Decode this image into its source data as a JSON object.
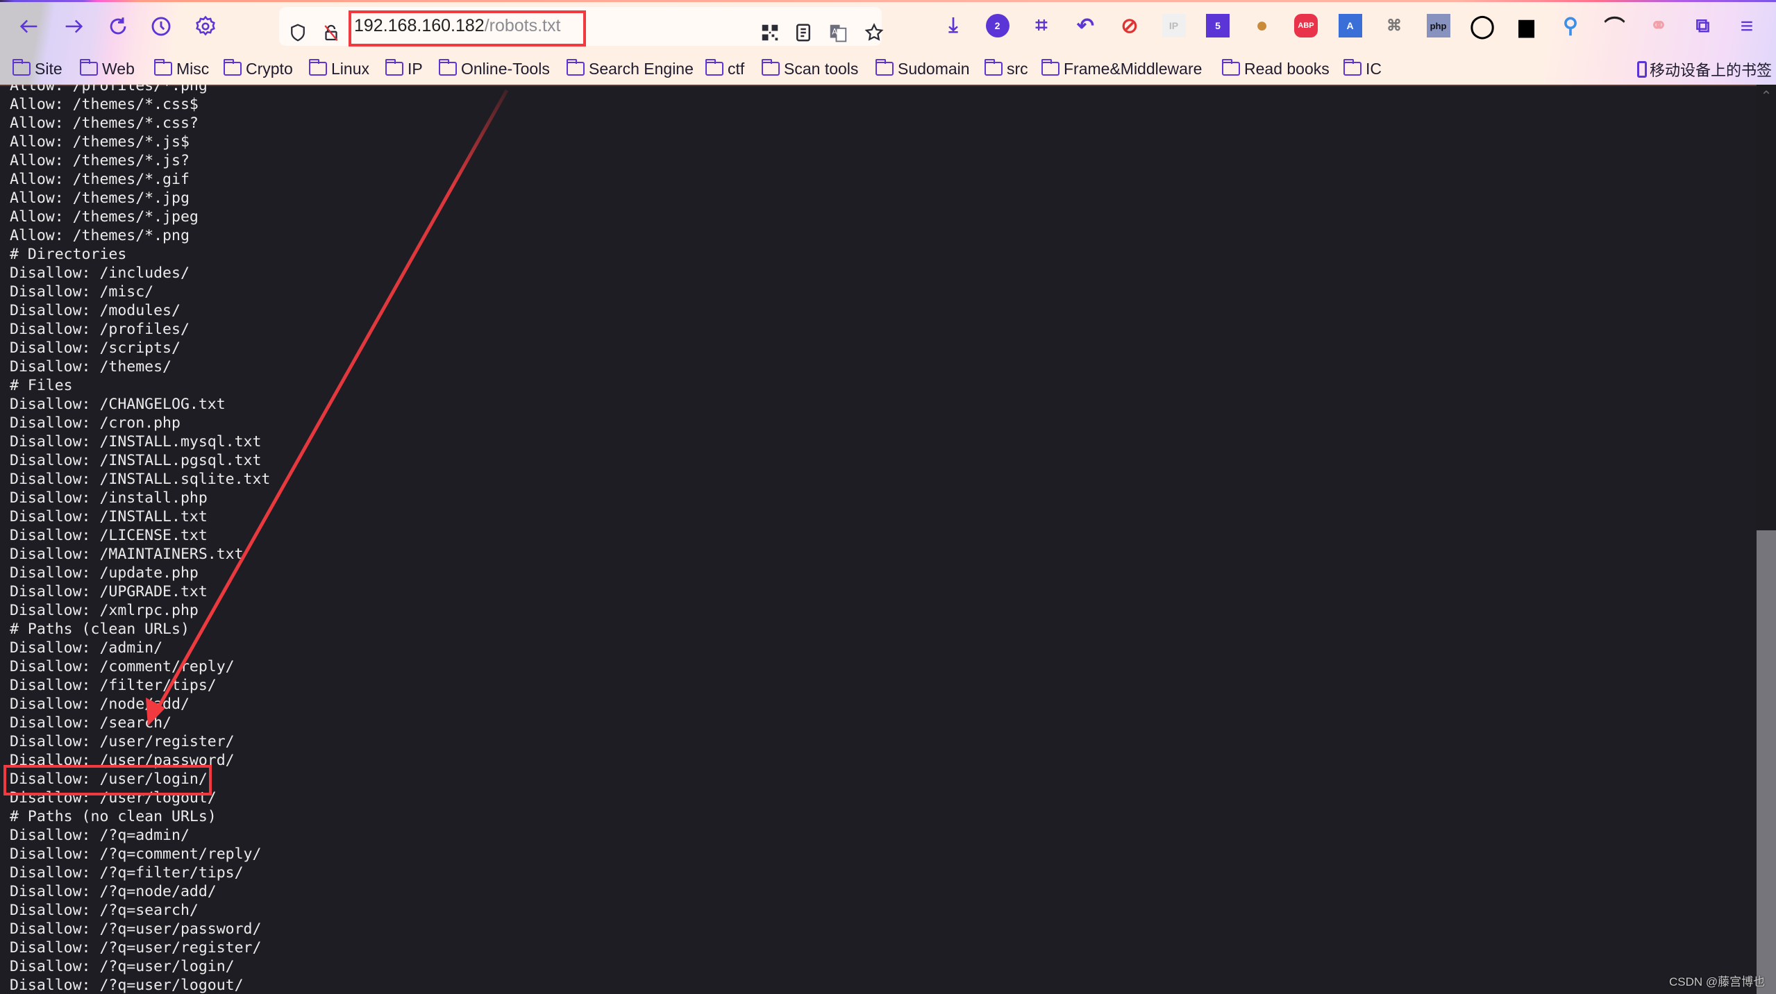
{
  "browser": {
    "nav": {
      "back_icon": "arrow-left-icon",
      "forward_icon": "arrow-right-icon",
      "reload_icon": "reload-icon",
      "history_icon": "clock-icon",
      "settings_icon": "gear-icon"
    },
    "url": {
      "host": "192.168.160.182",
      "path": "/robots.txt",
      "security_icon": "shield-icon",
      "insecure_icon": "lock-slash-icon"
    },
    "url_actions": [
      "qr-code-icon",
      "reader-view-icon",
      "translate-icon",
      "bookmark-star-icon"
    ],
    "extensions": [
      {
        "name": "download-icon",
        "label": ""
      },
      {
        "name": "extension-2-icon",
        "label": "2"
      },
      {
        "name": "crop-icon",
        "label": ""
      },
      {
        "name": "undo-icon",
        "label": ""
      },
      {
        "name": "no-cookie-icon",
        "label": ""
      },
      {
        "name": "ip-icon",
        "label": "IP"
      },
      {
        "name": "hackbar-icon",
        "label": "5"
      },
      {
        "name": "cookie-icon",
        "label": ""
      },
      {
        "name": "adblock-icon",
        "label": "ABP"
      },
      {
        "name": "translate-ext-icon",
        "label": "A"
      },
      {
        "name": "cmd-icon",
        "label": "⌘"
      },
      {
        "name": "php-icon",
        "label": "php"
      },
      {
        "name": "ring-icon",
        "label": ""
      },
      {
        "name": "glasses-icon",
        "label": ""
      },
      {
        "name": "pin-icon",
        "label": ""
      },
      {
        "name": "hat-icon",
        "label": ""
      },
      {
        "name": "cluster-icon",
        "label": ""
      },
      {
        "name": "puzzle-icon",
        "label": ""
      },
      {
        "name": "menu-icon",
        "label": "≡"
      }
    ],
    "bookmarks": [
      "Site",
      "Web",
      "Misc",
      "Crypto",
      "Linux",
      "IP",
      "Online-Tools",
      "Search Engine",
      "ctf",
      "Scan tools",
      "Sudomain",
      "src",
      "Frame&Middleware",
      "Read books",
      "IC"
    ],
    "mobile_bookmarks": "移动设备上的书签"
  },
  "accent_colors": {
    "icon": "#5b35d5",
    "annotation": "#f03a3f",
    "page_background": "#1e1d23",
    "text": "#ececec"
  },
  "robots_lines": [
    "Allow: /profiles/*.png",
    "Allow: /themes/*.css$",
    "Allow: /themes/*.css?",
    "Allow: /themes/*.js$",
    "Allow: /themes/*.js?",
    "Allow: /themes/*.gif",
    "Allow: /themes/*.jpg",
    "Allow: /themes/*.jpeg",
    "Allow: /themes/*.png",
    "# Directories",
    "Disallow: /includes/",
    "Disallow: /misc/",
    "Disallow: /modules/",
    "Disallow: /profiles/",
    "Disallow: /scripts/",
    "Disallow: /themes/",
    "# Files",
    "Disallow: /CHANGELOG.txt",
    "Disallow: /cron.php",
    "Disallow: /INSTALL.mysql.txt",
    "Disallow: /INSTALL.pgsql.txt",
    "Disallow: /INSTALL.sqlite.txt",
    "Disallow: /install.php",
    "Disallow: /INSTALL.txt",
    "Disallow: /LICENSE.txt",
    "Disallow: /MAINTAINERS.txt",
    "Disallow: /update.php",
    "Disallow: /UPGRADE.txt",
    "Disallow: /xmlrpc.php",
    "# Paths (clean URLs)",
    "Disallow: /admin/",
    "Disallow: /comment/reply/",
    "Disallow: /filter/tips/",
    "Disallow: /node/add/",
    "Disallow: /search/",
    "Disallow: /user/register/",
    "Disallow: /user/password/",
    "Disallow: /user/login/",
    "Disallow: /user/logout/",
    "# Paths (no clean URLs)",
    "Disallow: /?q=admin/",
    "Disallow: /?q=comment/reply/",
    "Disallow: /?q=filter/tips/",
    "Disallow: /?q=node/add/",
    "Disallow: /?q=search/",
    "Disallow: /?q=user/password/",
    "Disallow: /?q=user/register/",
    "Disallow: /?q=user/login/",
    "Disallow: /?q=user/logout/"
  ],
  "annotation": {
    "highlighted_line": "Disallow: /user/login/",
    "highlighted_url": "192.168.160.182/robots.txt"
  },
  "scroll": {
    "thumb_start_fraction": 0.49,
    "thumb_end_fraction": 1.0
  },
  "watermark": "CSDN @藤宫博也"
}
